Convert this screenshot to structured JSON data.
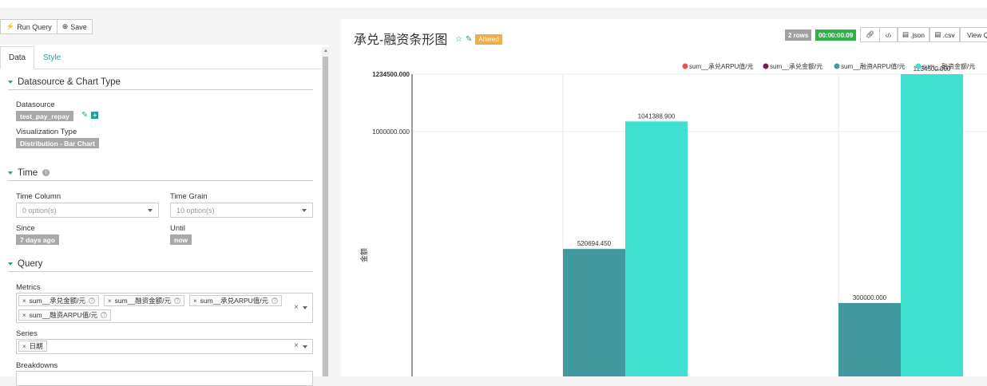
{
  "toolbar": {
    "run_query_label": "Run Query",
    "save_label": "Save"
  },
  "tabs": {
    "data": "Data",
    "style": "Style"
  },
  "sections": {
    "datasource": {
      "title": "Datasource & Chart Type",
      "datasource_label": "Datasource",
      "datasource_value": "test_pay_repay",
      "viz_label": "Visualization Type",
      "viz_value": "Distribution - Bar Chart"
    },
    "time": {
      "title": "Time",
      "time_column_label": "Time Column",
      "time_column_placeholder": "0 option(s)",
      "time_grain_label": "Time Grain",
      "time_grain_placeholder": "10 option(s)",
      "since_label": "Since",
      "since_value": "7 days ago",
      "until_label": "Until",
      "until_value": "now"
    },
    "query": {
      "title": "Query",
      "metrics_label": "Metrics",
      "metrics": [
        "sum__承兑金额/元",
        "sum__融资金额/元",
        "sum__承兑ARPU值/元",
        "sum__融资ARPU值/元"
      ],
      "series_label": "Series",
      "series": [
        "日期"
      ],
      "breakdowns_label": "Breakdowns"
    }
  },
  "slice": {
    "title": "承兑-融资条形图",
    "altered_label": "Altered",
    "rows_badge": "2 rows",
    "timer_badge": "00:00:00.09",
    "json_label": ".json",
    "csv_label": ".csv",
    "view_query_label": "View Q"
  },
  "colors": {
    "accent": "#1aa39a",
    "series_1": "#ef5350",
    "series_2": "#7b1a52",
    "series_3": "#41999e",
    "series_4": "#40e0d0"
  },
  "chart_data": {
    "type": "bar",
    "title": "",
    "ylabel": "金额",
    "ylim": [
      0,
      1234500
    ],
    "y_ticks": [
      "1234500.000",
      "1000000.000"
    ],
    "legend_position": "top-right",
    "series": [
      {
        "name": "sum__承兑ARPU值/元",
        "values": [
          null,
          null
        ]
      },
      {
        "name": "sum__承兑金额/元",
        "values": [
          null,
          null
        ]
      },
      {
        "name": "sum__融资ARPU值/元",
        "values": [
          520694.45,
          300000.0
        ]
      },
      {
        "name": "sum__融资金额/元",
        "values": [
          1041388.9,
          1234500.0
        ]
      }
    ],
    "value_labels": [
      "520694.450",
      "1041388.900",
      "300000.000",
      "1234500.000"
    ]
  }
}
